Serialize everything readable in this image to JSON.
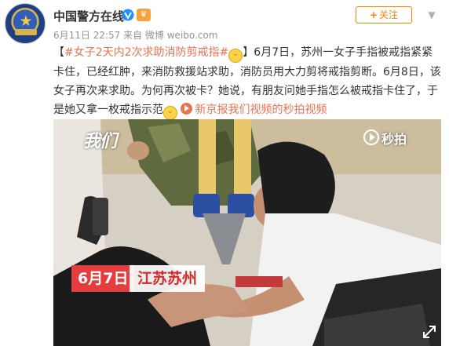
{
  "account": {
    "name": "中国警方在线",
    "verified_badge": "verified-v-icon",
    "vip_badge": "vip-icon",
    "meta": "6月11日 22:57 来自 微博 weibo.com"
  },
  "actions": {
    "follow_label": "关注",
    "follow_plus": "+",
    "more_icon": "chevron-down-icon"
  },
  "post": {
    "hashtag": "#女子2天内2次求助消防剪戒指#",
    "text": "6月7日，苏州一女子手指被戒指紧紧卡住，已经红肿，来消防救援站求助，消防员用大力剪将戒指剪断。6月8日，该女子再次来求助。为何再次被卡？她说，有朋友问她手指怎么被戒指卡住了，于是她又拿一枚戒指示范",
    "video_link": "新京报我们视频的秒拍视频",
    "emoji_1": "doge-emoji-icon",
    "emoji_2": "laugh-emoji-icon"
  },
  "video": {
    "watermark": "我们",
    "platform": "秒拍",
    "date_tag": "6月7日",
    "location_tag": "江苏苏州"
  },
  "colors": {
    "link": "#eb7350",
    "follow": "#ff8200",
    "tag_red": "#e43d3d"
  }
}
